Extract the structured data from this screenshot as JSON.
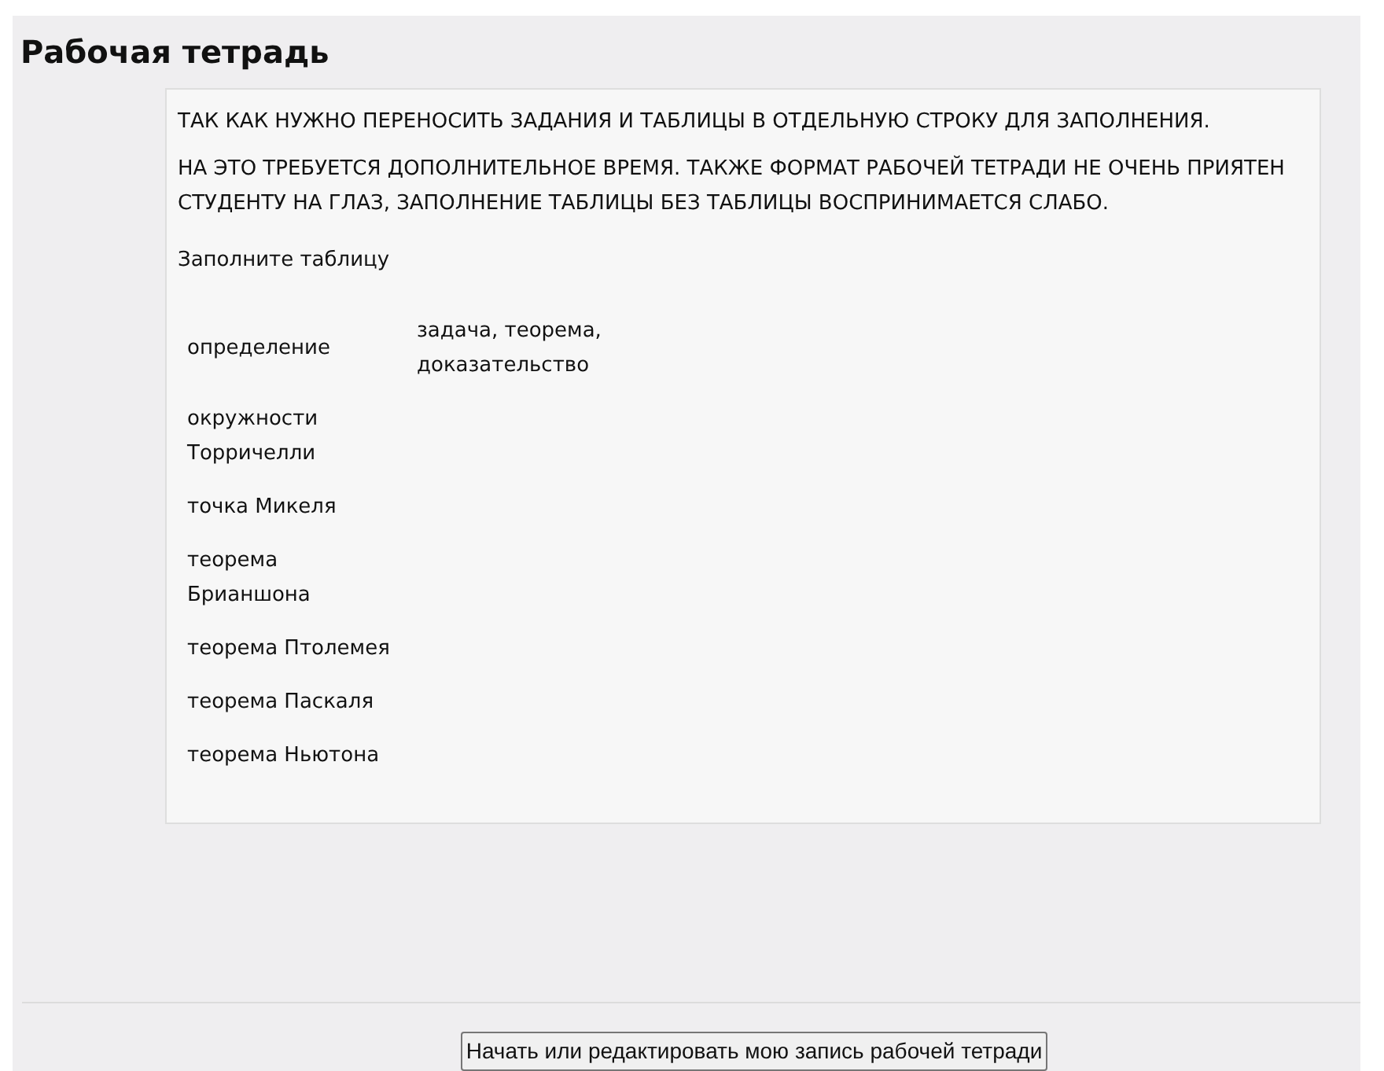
{
  "title": "Рабочая тетрадь",
  "paragraphs": [
    "ТАК КАК НУЖНО ПЕРЕНОСИТЬ ЗАДАНИЯ И ТАБЛИЦЫ В ОТДЕЛЬНУЮ СТРОКУ ДЛЯ ЗАПОЛНЕНИЯ.",
    "НА ЭТО ТРЕБУЕТСЯ ДОПОЛНИТЕЛЬНОЕ ВРЕМЯ. ТАКЖЕ ФОРМАТ РАБОЧЕЙ ТЕТРАДИ НЕ ОЧЕНЬ ПРИЯТЕН СТУДЕНТУ НА ГЛАЗ, ЗАПОЛНЕНИЕ ТАБЛИЦЫ БЕЗ ТАБЛИЦЫ ВОСПРИНИМАЕТСЯ СЛАБО.",
    "Заполните таблицу"
  ],
  "table": {
    "rows": [
      {
        "cells": [
          "определение",
          "задача, теорема, доказательство"
        ]
      },
      {
        "cells": [
          "окружности Торричелли"
        ]
      },
      {
        "cells": [
          "точка Микеля"
        ]
      },
      {
        "cells": [
          "теорема Брианшона"
        ]
      },
      {
        "cells": [
          "теорема Птолемея"
        ]
      },
      {
        "cells": [
          "теорема Паскаля"
        ]
      },
      {
        "cells": [
          "теорема Ньютона"
        ]
      }
    ]
  },
  "button": "Начать или редактировать мою запись рабочей тетради"
}
